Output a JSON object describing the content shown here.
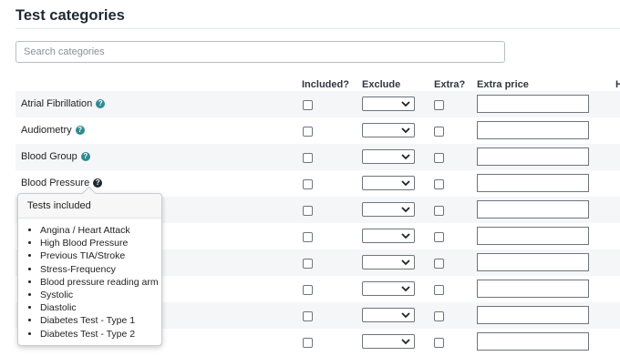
{
  "page": {
    "title": "Test categories"
  },
  "search": {
    "placeholder": "Search categories",
    "value": ""
  },
  "table": {
    "headers": {
      "included": "Included?",
      "exclude": "Exclude",
      "extra": "Extra?",
      "extra_price": "Extra price",
      "cut_off": "H"
    },
    "rows": [
      {
        "label": "Atrial Fibrillation"
      },
      {
        "label": "Audiometry"
      },
      {
        "label": "Blood Group"
      },
      {
        "label": "Blood Pressure"
      },
      {
        "label": ""
      },
      {
        "label": ""
      },
      {
        "label": ""
      },
      {
        "label": ""
      },
      {
        "label": ""
      },
      {
        "label": ""
      }
    ]
  },
  "popover": {
    "title": "Tests included",
    "items": [
      "Angina / Heart Attack",
      "High Blood Pressure",
      "Previous TIA/Stroke",
      "Stress-Frequency",
      "Blood pressure reading arm",
      "Systolic",
      "Diastolic",
      "Diabetes Test - Type 1",
      "Diabetes Test - Type 2"
    ]
  },
  "icons": {
    "help": "question-circle-icon",
    "dropdown": "chevron-down-icon"
  },
  "colors": {
    "help_icon": "#2e8b8f",
    "help_icon_active": "#1f2933"
  }
}
